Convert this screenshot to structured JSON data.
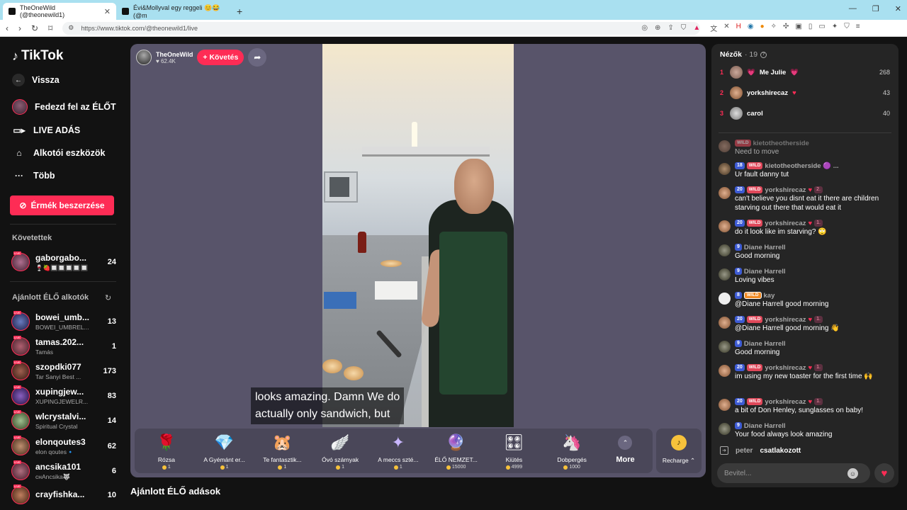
{
  "browser": {
    "tabs": [
      {
        "title": "TheOneWild (@theonewild1)"
      },
      {
        "title": "Évi&Mollyval egy reggeli 😊😂 (@m"
      }
    ],
    "url": "https://www.tiktok.com/@theonewild1/live"
  },
  "sidebar": {
    "logo": "TikTok",
    "back": "Vissza",
    "nav": [
      {
        "label": "Fedezd fel az ÉLŐT",
        "icon": "explore-live-icon"
      },
      {
        "label": "LIVE ADÁS",
        "icon": "video-camera-icon"
      },
      {
        "label": "Alkotói eszközök",
        "icon": "home-tools-icon"
      },
      {
        "label": "Több",
        "icon": "more-dots-icon"
      }
    ],
    "coins_button": "Érmék beszerzése",
    "following_title": "Követettek",
    "following": [
      {
        "name": "gaborgabo...",
        "sub": "🍷🍓🔲🔲🔲🔲🔲",
        "count": "24"
      }
    ],
    "recommended_title": "Ajánlott ÉLŐ alkotók",
    "recommended": [
      {
        "name": "bowei_umb...",
        "sub": "BOWEI_UMBREL...",
        "count": "13"
      },
      {
        "name": "tamas.202...",
        "sub": "Tamás",
        "count": "1"
      },
      {
        "name": "szopdki077",
        "sub": "Tar Sanyi Best ...",
        "count": "173"
      },
      {
        "name": "xupingjew...",
        "sub": "XUPINGJEWELR...",
        "count": "83"
      },
      {
        "name": "wlcrystalvi...",
        "sub": "Spiritual Crystal",
        "count": "14"
      },
      {
        "name": "elonqoutes3",
        "sub": "elon qoutes🔹",
        "count": "62"
      },
      {
        "name": "ancsika101",
        "sub": "ᴄʜAncsika🐺",
        "count": "6"
      },
      {
        "name": "crayfishka...",
        "sub": "",
        "count": "10"
      }
    ]
  },
  "stream": {
    "host_name": "TheOneWild",
    "host_likes": "62.4K",
    "follow_label": "+ Követés",
    "caption_lines": [
      "looks amazing. Damn We do",
      "actually only sandwich, but"
    ],
    "gifts": [
      {
        "name": "Rózsa",
        "price": "1",
        "icon": "🌹"
      },
      {
        "name": "A Gyémánt er...",
        "price": "1",
        "icon": "💎"
      },
      {
        "name": "Te fantasztik...",
        "price": "1",
        "icon": "🐹"
      },
      {
        "name": "Óvó szárnyak",
        "price": "1",
        "icon": "🪽"
      },
      {
        "name": "A meccs szté...",
        "price": "1",
        "icon": "✦"
      },
      {
        "name": "ÉLŐ NEMZET...",
        "price": "15000",
        "icon": "🔮"
      },
      {
        "name": "Kiütés",
        "price": "4999",
        "icon": "🎛"
      },
      {
        "name": "Dobpergés",
        "price": "1000",
        "icon": "🦄"
      }
    ],
    "more_label": "More",
    "recharge_label": "Recharge",
    "recommended_streams_title": "Ajánlott ÉLŐ adások"
  },
  "chat": {
    "viewers_label": "Nézők",
    "viewers_count": "· 19",
    "top_viewers": [
      {
        "rank": "1",
        "name": "Me Julie",
        "score": "268"
      },
      {
        "rank": "2",
        "name": "yorkshirecaz",
        "score": "43"
      },
      {
        "rank": "3",
        "name": "carol",
        "score": "40"
      }
    ],
    "messages": [
      {
        "level": "",
        "wild": "WILD",
        "user": "kietotheotherside",
        "fan": "",
        "text": "Need to move"
      },
      {
        "level": "18",
        "wild": "WILD",
        "user": "kietotheotherside 🟣 ...",
        "fan": "",
        "text": "Ur fault danny tut"
      },
      {
        "level": "20",
        "wild": "WILD",
        "user": "yorkshirecaz",
        "fan": "2.",
        "text": "can't believe you disnt eat it there are children starving out there that would eat it"
      },
      {
        "level": "20",
        "wild": "WILD",
        "user": "yorkshirecaz",
        "fan": "1.",
        "text": "do it look like im starving? 🙄"
      },
      {
        "level": "9",
        "wild": "",
        "user": "Diane Harrell",
        "fan": "",
        "text": "Good morning"
      },
      {
        "level": "9",
        "wild": "",
        "user": "Diane Harrell",
        "fan": "",
        "text": "Loving vibes"
      },
      {
        "level": "8",
        "wild": "WILD",
        "user": "kay",
        "fan": "",
        "text": "@Diane Harrell good morning"
      },
      {
        "level": "20",
        "wild": "WILD",
        "user": "yorkshirecaz",
        "fan": "1.",
        "text": "@Diane Harrell good morning 👋"
      },
      {
        "level": "9",
        "wild": "",
        "user": "Diane Harrell",
        "fan": "",
        "text": "Good morning"
      },
      {
        "level": "20",
        "wild": "WILD",
        "user": "yorkshirecaz",
        "fan": "1.",
        "text": "im using my new toaster for the first time 🙌"
      },
      {
        "level": "20",
        "wild": "WILD",
        "user": "yorkshirecaz",
        "fan": "1.",
        "text": "a bit of Don Henley, sunglasses on baby!"
      },
      {
        "level": "9",
        "wild": "",
        "user": "Diane Harrell",
        "fan": "",
        "text": "Your food always look amazing"
      }
    ],
    "joined_user": "peter",
    "joined_text": "csatlakozott",
    "input_placeholder": "Bevitel..."
  },
  "colors": {
    "accent": "#fe2c55",
    "stream_bg": "#58546a",
    "chat_bg": "#252525"
  }
}
